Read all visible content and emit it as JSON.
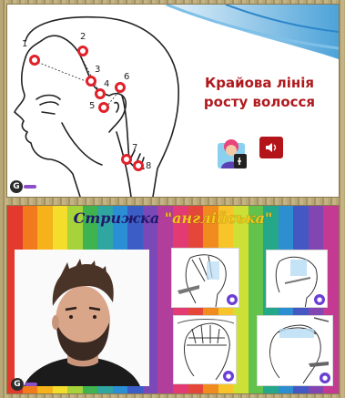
{
  "slide_top": {
    "title_line1": "Крайова лінія",
    "title_line2": "росту волосся",
    "markers": [
      "1",
      "2",
      "3",
      "4",
      "5",
      "6",
      "7",
      "8"
    ],
    "accent_color": "#b0191d",
    "marker_color": "#e0212a",
    "icons": [
      "speaker-icon",
      "avatar-icon",
      "logo-icon"
    ]
  },
  "slide_bottom": {
    "title_word1": "Стрижка",
    "title_word2": "\"англійська\"",
    "title_color": "#1f1a6b",
    "title_accent_color": "#f2c919",
    "badge_color": "#6b3fd4",
    "stripe_colors": [
      "#e23a2c",
      "#f07a1c",
      "#f5b21b",
      "#f4dd2b",
      "#a6d23a",
      "#3fb34f",
      "#2fa6a0",
      "#2b8fd6",
      "#3b5ec6",
      "#7b48b7",
      "#b23e9c",
      "#e23a73",
      "#e5463a",
      "#f08c1f",
      "#f7c52a",
      "#cde035",
      "#62c24c",
      "#24a889",
      "#2d8fd0",
      "#4358c2",
      "#8246b2",
      "#c43992"
    ]
  }
}
